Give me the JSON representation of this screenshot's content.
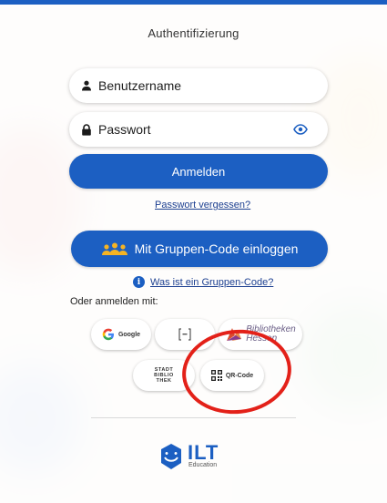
{
  "page": {
    "title": "Authentifizierung"
  },
  "form": {
    "username_placeholder": "Benutzername",
    "password_placeholder": "Passwort",
    "login_label": "Anmelden",
    "forgot_label": "Passwort vergessen?",
    "group_login_label": "Mit Gruppen-Code einloggen",
    "group_info_label": "Was ist ein Gruppen-Code?",
    "other_label": "Oder anmelden mit:"
  },
  "providers": {
    "google": "Google",
    "bibliotheken_line1": "Bibliotheken",
    "bibliotheken_line2": "Hessen",
    "stadtbib_line1": "STADT",
    "stadtbib_line2": "BIBLIO",
    "stadtbib_line3": "THEK",
    "qr": "QR-Code"
  },
  "logo": {
    "name": "ILT",
    "sub": "Education"
  },
  "colors": {
    "primary": "#1c5fc2",
    "annotation": "#e32119",
    "group_icon": "#f5b324"
  }
}
